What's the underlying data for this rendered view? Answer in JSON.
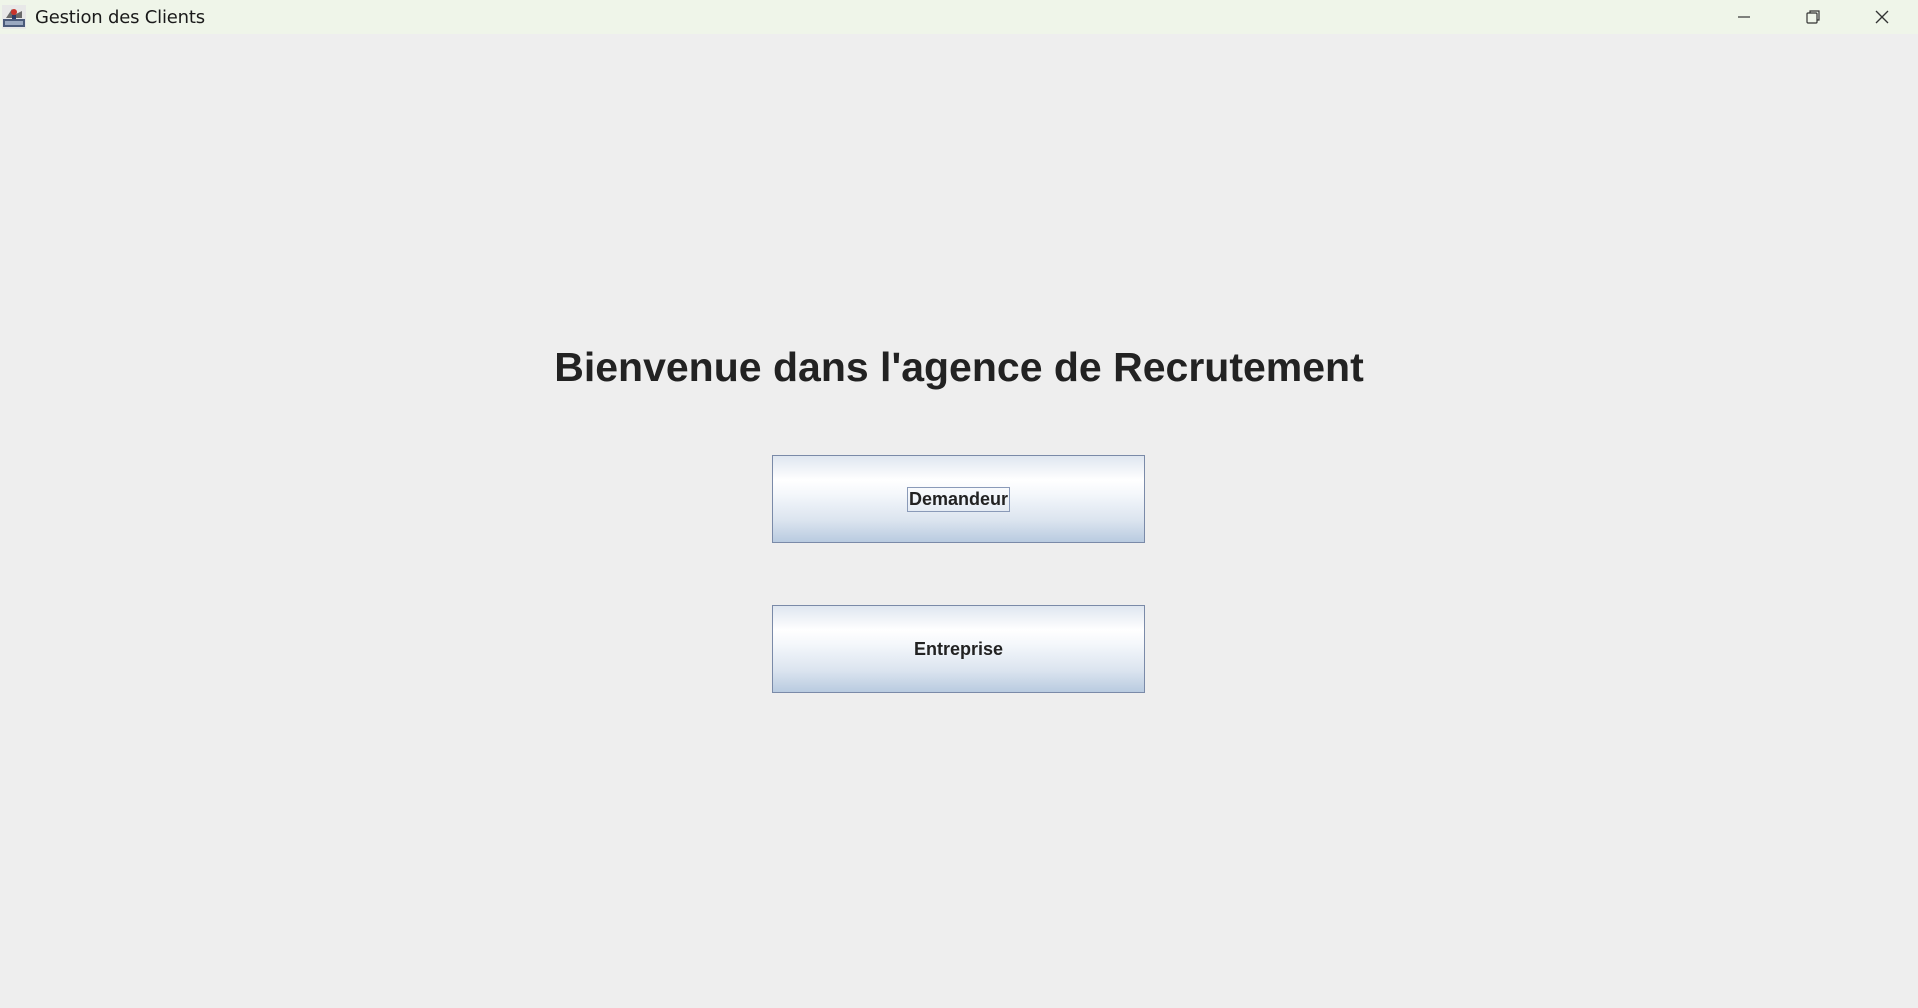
{
  "window": {
    "title": "Gestion des Clients",
    "icons": {
      "app": "java-app-icon",
      "minimize": "minimize-icon",
      "maximize": "maximize-restore-icon",
      "close": "close-icon"
    }
  },
  "main": {
    "welcome_text": "Bienvenue dans l'agence de Recrutement",
    "buttons": {
      "demandeur_label": "Demandeur",
      "entreprise_label": "Entreprise"
    }
  },
  "colors": {
    "background": "#eeeeee",
    "titlebar": "#eff5e9",
    "text": "#222222",
    "button_border": "#7a8aa8"
  }
}
